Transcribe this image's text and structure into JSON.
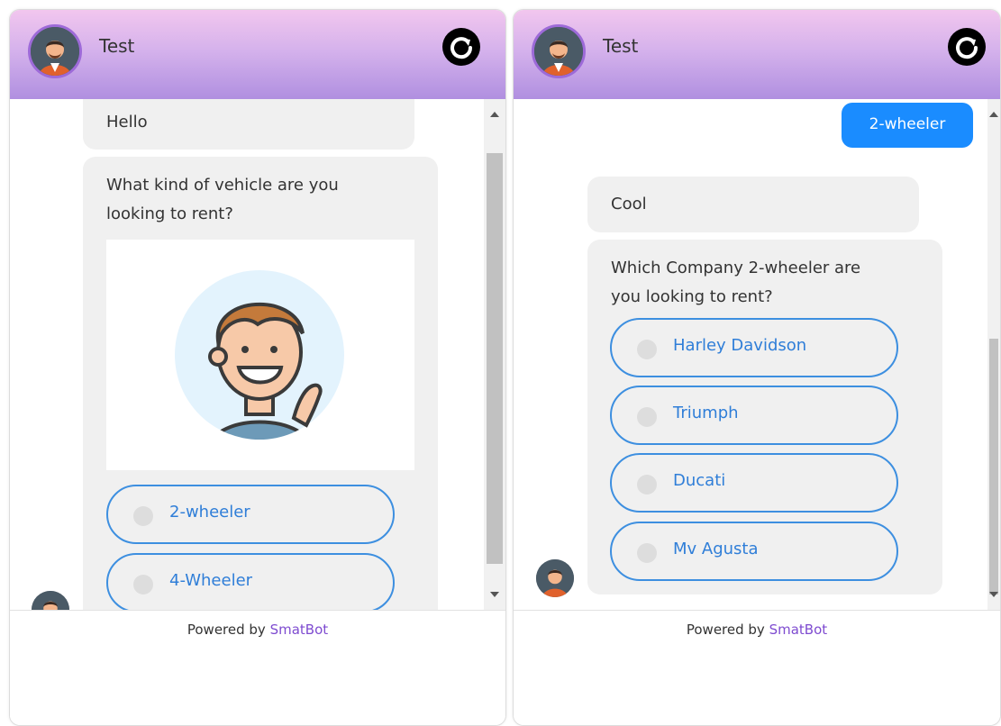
{
  "left_panel": {
    "bot_name": "Test",
    "messages": {
      "greeting": "Hello",
      "question_line1": "What kind of vehicle are you",
      "question_line2": "looking to rent?"
    },
    "options": [
      "2-wheeler",
      "4-Wheeler"
    ],
    "footer_prefix": "Powered by ",
    "footer_brand": "SmatBot"
  },
  "right_panel": {
    "bot_name": "Test",
    "user_reply": "2-wheeler",
    "messages": {
      "ack": "Cool",
      "question_line1": "Which Company 2-wheeler are",
      "question_line2": "you looking to rent?"
    },
    "options": [
      "Harley Davidson",
      "Triumph",
      "Ducati",
      "Mv Agusta"
    ],
    "footer_prefix": "Powered by ",
    "footer_brand": "SmatBot"
  },
  "colors": {
    "header_gradient_top": "#f2c6ee",
    "header_gradient_bottom": "#b08fe0",
    "option_border": "#3d8fe0",
    "user_bubble": "#1a8cff",
    "brand": "#7e4bd0"
  },
  "icons": [
    "refresh-icon",
    "bot-avatar",
    "waving-user-illustration"
  ]
}
